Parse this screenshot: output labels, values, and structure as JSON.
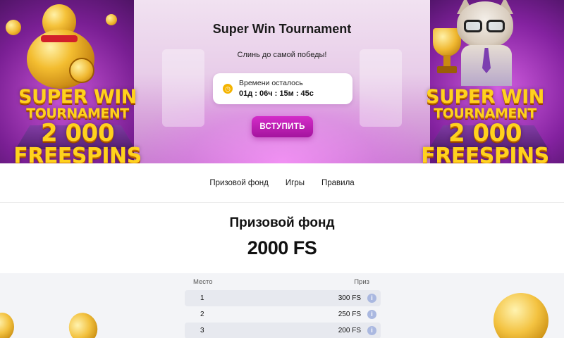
{
  "hero": {
    "title": "Super Win Tournament",
    "subtitle": "Слинь до самой победы!",
    "timer_label": "Времени осталось",
    "timer_value": "01д : 06ч : 15м : 45с",
    "join_button": "ВСТУПИТЬ",
    "promo_left": {
      "line1": "SUPER WIN",
      "line2": "TOURNAMENT",
      "line3": "2 000",
      "line4": "FREESPINS"
    },
    "promo_right": {
      "line1": "SUPER WIN",
      "line2": "TOURNAMENT",
      "line3": "2 000",
      "line4": "FREESPINS"
    }
  },
  "tabs": [
    "Призовой фонд",
    "Игры",
    "Правила"
  ],
  "prize": {
    "heading": "Призовой фонд",
    "total": "2000 FS",
    "table": {
      "headers": {
        "place": "Место",
        "prize": "Приз"
      },
      "rows": [
        {
          "place": "1",
          "amount": "300 FS"
        },
        {
          "place": "2",
          "amount": "250 FS"
        },
        {
          "place": "3",
          "amount": "200 FS"
        }
      ]
    }
  },
  "icons": {
    "timer": "clock-icon",
    "info": "info-icon"
  },
  "colors": {
    "accent": "#c41fbd",
    "promo_gold": "#ffd21e",
    "timer_icon": "#f4b400"
  }
}
